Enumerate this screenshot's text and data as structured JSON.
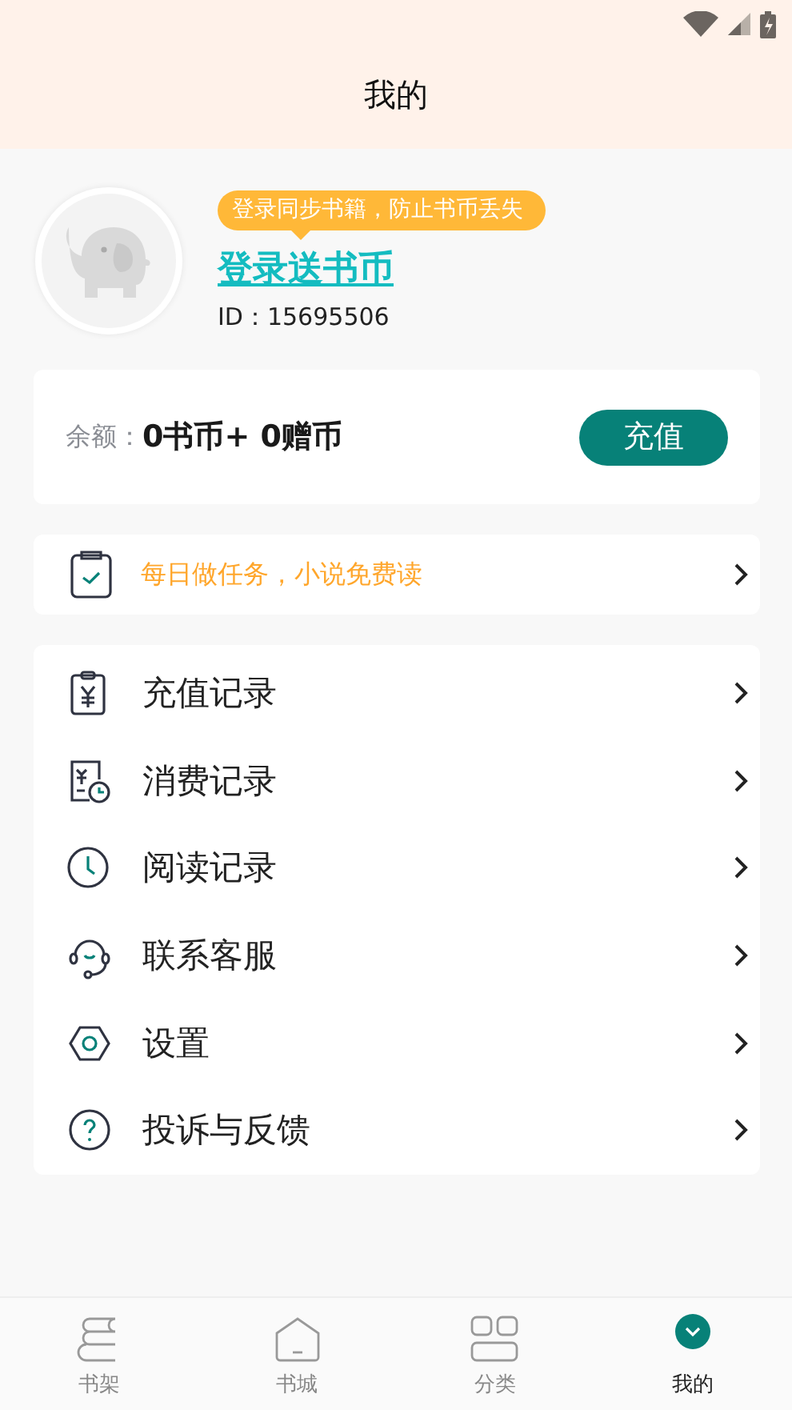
{
  "header": {
    "title": "我的"
  },
  "profile": {
    "tip": "登录同步书籍，防止书币丢失",
    "login_link": "登录送书币",
    "id_label": "ID：15695506"
  },
  "balance": {
    "label": "余额：",
    "value": "0书币+ 0赠币",
    "button": "充值"
  },
  "task_banner": {
    "text": "每日做任务，小说免费读"
  },
  "menu": [
    {
      "label": "充值记录"
    },
    {
      "label": "消费记录"
    },
    {
      "label": "阅读记录"
    },
    {
      "label": "联系客服"
    },
    {
      "label": "设置"
    },
    {
      "label": "投诉与反馈"
    }
  ],
  "bottom_nav": [
    {
      "label": "书架",
      "selected": false
    },
    {
      "label": "书城",
      "selected": false
    },
    {
      "label": "分类",
      "selected": false
    },
    {
      "label": "我的",
      "selected": true
    }
  ]
}
